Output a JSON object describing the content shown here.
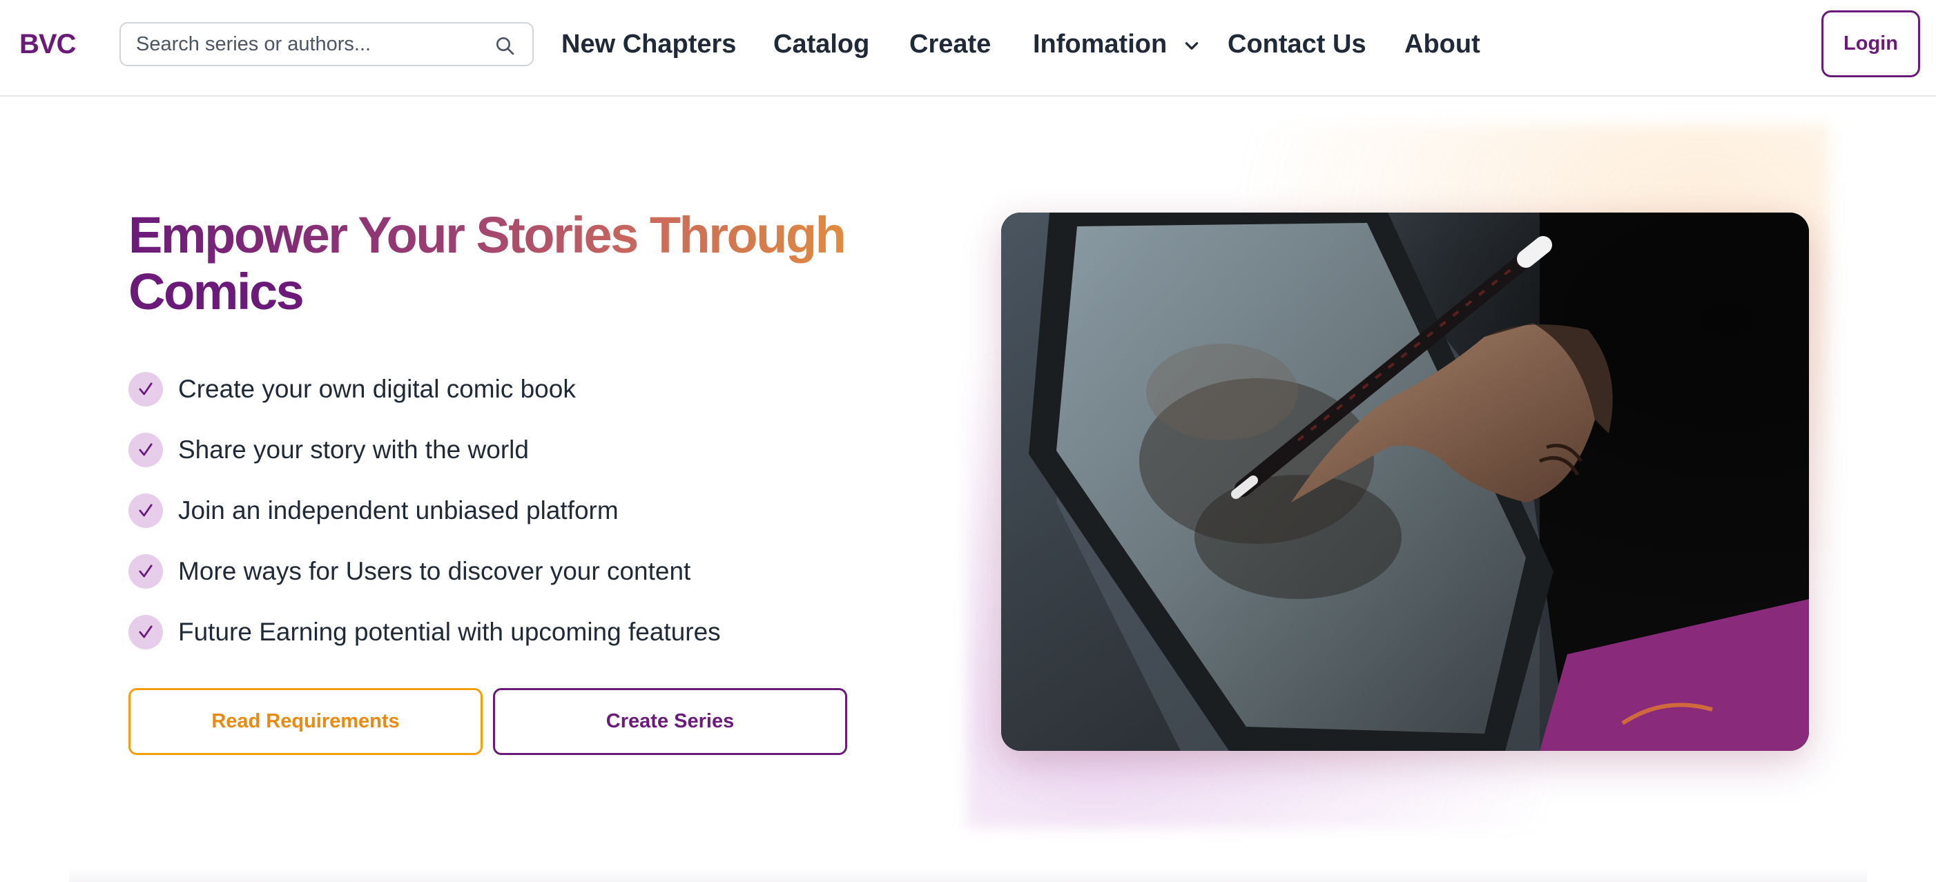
{
  "navbar": {
    "logo": "BVC",
    "search": {
      "placeholder": "Search series or authors...",
      "value": ""
    },
    "items": [
      {
        "label": "New Chapters"
      },
      {
        "label": "Catalog"
      },
      {
        "label": "Create"
      },
      {
        "label": "Infomation",
        "has_dropdown": true
      },
      {
        "label": "Contact Us"
      },
      {
        "label": "About"
      }
    ],
    "login_label": "Login"
  },
  "hero": {
    "title_line1": "Empower Your Stories Through",
    "title_line2": "Comics",
    "features": [
      "Create your own digital comic book",
      "Share your story with the world",
      "Join an independent unbiased platform",
      "More ways for Users to discover your content",
      "Future Earning potential with upcoming features"
    ],
    "buttons": {
      "read_requirements": "Read Requirements",
      "create_series": "Create Series"
    },
    "image_alt": "Artist drawing on a tablet with a stylus"
  },
  "colors": {
    "brand_purple": "#6b1a7a",
    "brand_orange": "#ea8a12",
    "check_bg": "#e6cdea"
  }
}
